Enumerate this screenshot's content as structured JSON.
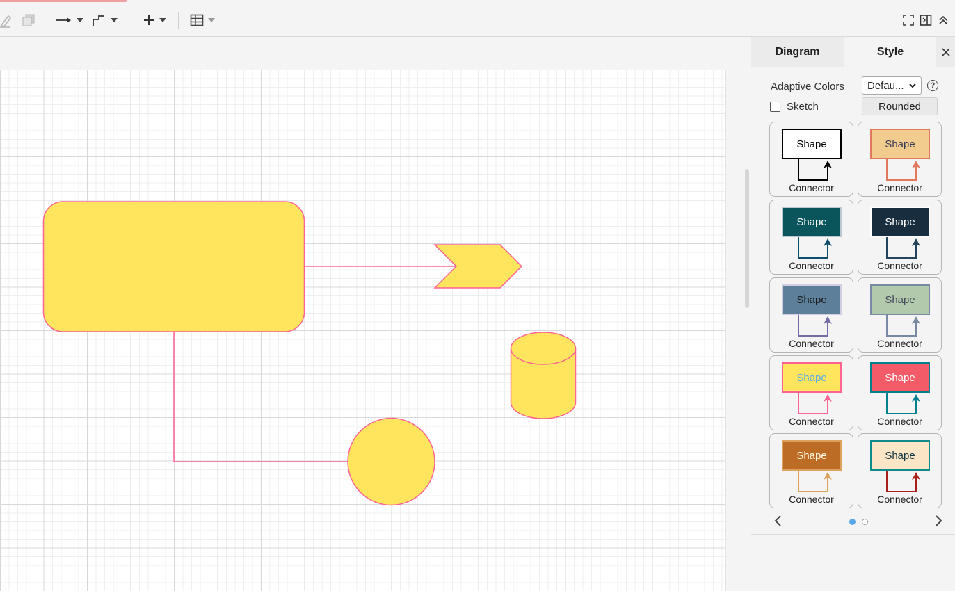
{
  "toolbar": {
    "icons": [
      "edit-icon",
      "duplicate-icon",
      "connection-arrow-icon",
      "waypoint-icon",
      "insert-plus-icon",
      "table-icon",
      "fullscreen-icon",
      "format-panel-icon",
      "collapse-icon"
    ]
  },
  "panel": {
    "tabs": {
      "diagram": "Diagram",
      "style": "Style"
    },
    "adaptive_colors_label": "Adaptive Colors",
    "adaptive_colors_value": "Defau...",
    "help_glyph": "?",
    "sketch_label": "Sketch",
    "sketch_checked": false,
    "rounded_label": "Rounded",
    "swatches": [
      {
        "shape_label": "Shape",
        "connector_label": "Connector",
        "fill": "#ffffff",
        "stroke": "#000000",
        "text": "#000000",
        "line": "#000000"
      },
      {
        "shape_label": "Shape",
        "connector_label": "Connector",
        "fill": "#f2cc8f",
        "stroke": "#e07a5f",
        "text": "#393c56",
        "line": "#e07a5f"
      },
      {
        "shape_label": "Shape",
        "connector_label": "Connector",
        "fill": "#09555b",
        "stroke": "#bac8d3",
        "text": "#ffffff",
        "line": "#0b4d6a"
      },
      {
        "shape_label": "Shape",
        "connector_label": "Connector",
        "fill": "#182e3e",
        "stroke": "#ffffff",
        "text": "#ffffff",
        "line": "#23445d"
      },
      {
        "shape_label": "Shape",
        "connector_label": "Connector",
        "fill": "#5d7f99",
        "stroke": "#d0cee2",
        "text": "#1a1a1a",
        "line": "#736ca8"
      },
      {
        "shape_label": "Shape",
        "connector_label": "Connector",
        "fill": "#b2c9ab",
        "stroke": "#788aa3",
        "text": "#46495d",
        "line": "#788aa3"
      },
      {
        "shape_label": "Shape",
        "connector_label": "Connector",
        "fill": "#ffe45e",
        "stroke": "#ff6392",
        "text": "#5aa9e6",
        "line": "#ff6392"
      },
      {
        "shape_label": "Shape",
        "connector_label": "Connector",
        "fill": "#f45b69",
        "stroke": "#028090",
        "text": "#ffffff",
        "line": "#028090"
      },
      {
        "shape_label": "Shape",
        "connector_label": "Connector",
        "fill": "#bc6c25",
        "stroke": "#dda15e",
        "text": "#fefae0",
        "line": "#dda15e"
      },
      {
        "shape_label": "Shape",
        "connector_label": "Connector",
        "fill": "#fae5c7",
        "stroke": "#0f8b8d",
        "text": "#143642",
        "line": "#a8201a"
      }
    ],
    "page_indicator": {
      "pages": 2,
      "current": 1
    }
  },
  "diagram": {
    "fill_color": "#ffe45e",
    "stroke_color": "#ff6392",
    "shapes": [
      "rounded-rectangle",
      "step-arrow",
      "cylinder",
      "circle"
    ],
    "connectors": [
      "rectangle-to-step",
      "rectangle-to-circle"
    ]
  }
}
